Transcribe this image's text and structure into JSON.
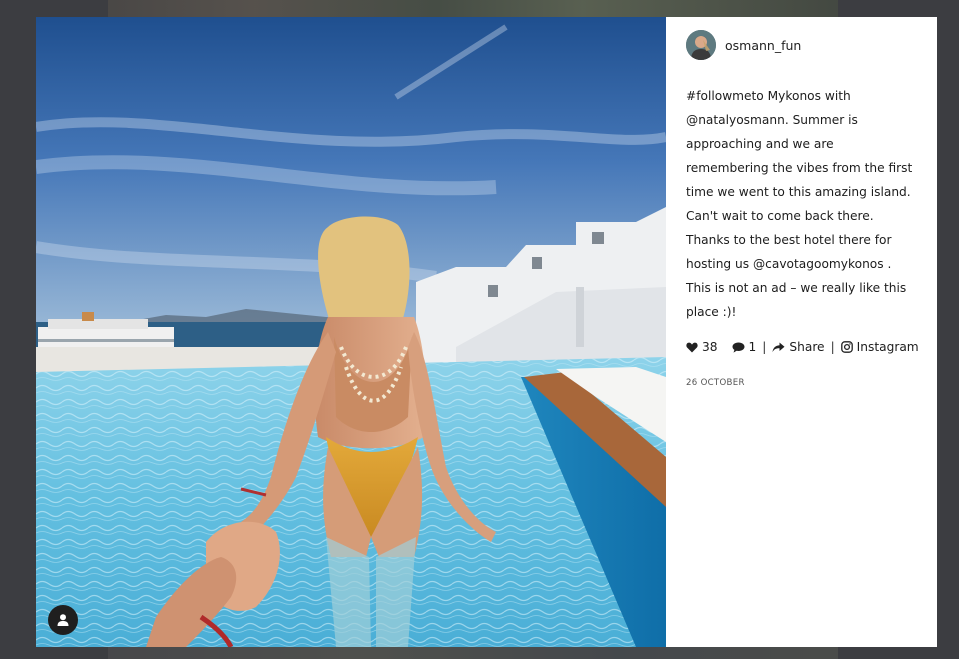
{
  "post": {
    "username": "osmann_fun",
    "caption": "#followmeto Mykonos with @natalyosmann. Summer is approaching and we are remembering the vibes from the first time we went to this amazing island. Can't wait to come back there. Thanks to the best hotel there for hosting us @cavotagoomykonos . This is not an ad – we really like this place :)!",
    "likes": "38",
    "comments": "1",
    "share_label": "Share",
    "instagram_label": "Instagram",
    "date": "26 October"
  },
  "icons": {
    "like": "heart-icon",
    "comment": "comment-icon",
    "share": "share-icon",
    "instagram": "instagram-icon",
    "user": "user-icon"
  },
  "colors": {
    "backdrop": "#3c3d41",
    "panel": "#ffffff",
    "text": "#1d1d1d"
  }
}
